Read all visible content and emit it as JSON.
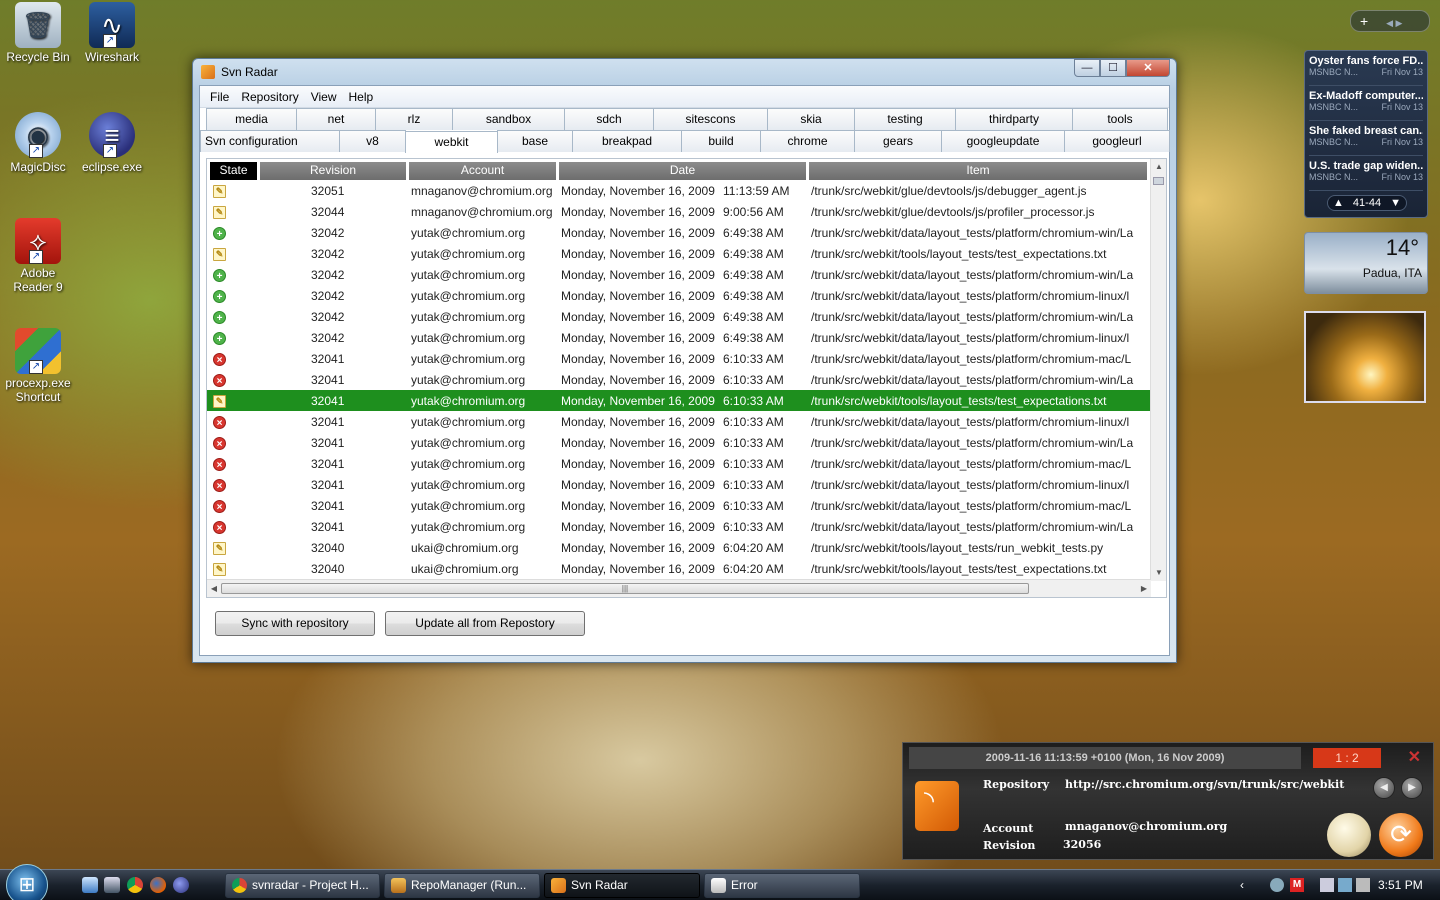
{
  "desktop": {
    "icons": [
      {
        "label": "Recycle Bin"
      },
      {
        "label": "Wireshark"
      },
      {
        "label": "MagicDisc"
      },
      {
        "label": "eclipse.exe"
      },
      {
        "label": "Adobe Reader 9"
      },
      {
        "label": "procexp.exe Shortcut"
      }
    ]
  },
  "window": {
    "title": "Svn Radar",
    "controls": {
      "minimize": "—",
      "maximize": "☐",
      "close": "✕"
    },
    "menu": [
      "File",
      "Repository",
      "View",
      "Help"
    ],
    "tabs_row1": [
      "media",
      "net",
      "rlz",
      "sandbox",
      "sdch",
      "sitescons",
      "skia",
      "testing",
      "thirdparty",
      "tools"
    ],
    "tabs_row2": [
      "Svn configuration",
      "v8",
      "webkit",
      "base",
      "breakpad",
      "build",
      "chrome",
      "gears",
      "googleupdate",
      "googleurl"
    ],
    "active_tab": "webkit",
    "columns": [
      "State",
      "Revision",
      "Account",
      "Date",
      "Item"
    ],
    "rows": [
      {
        "state": "modified",
        "revision": "32051",
        "account": "mnaganov@chromium.org",
        "date": "Monday, November 16, 2009",
        "time": "11:13:59 AM",
        "item": "/trunk/src/webkit/glue/devtools/js/debugger_agent.js"
      },
      {
        "state": "modified",
        "revision": "32044",
        "account": "mnaganov@chromium.org",
        "date": "Monday, November 16, 2009",
        "time": "9:00:56 AM",
        "item": "/trunk/src/webkit/glue/devtools/js/profiler_processor.js"
      },
      {
        "state": "added",
        "revision": "32042",
        "account": "yutak@chromium.org",
        "date": "Monday, November 16, 2009",
        "time": "6:49:38 AM",
        "item": "/trunk/src/webkit/data/layout_tests/platform/chromium-win/La"
      },
      {
        "state": "modified",
        "revision": "32042",
        "account": "yutak@chromium.org",
        "date": "Monday, November 16, 2009",
        "time": "6:49:38 AM",
        "item": "/trunk/src/webkit/tools/layout_tests/test_expectations.txt"
      },
      {
        "state": "added",
        "revision": "32042",
        "account": "yutak@chromium.org",
        "date": "Monday, November 16, 2009",
        "time": "6:49:38 AM",
        "item": "/trunk/src/webkit/data/layout_tests/platform/chromium-win/La"
      },
      {
        "state": "added",
        "revision": "32042",
        "account": "yutak@chromium.org",
        "date": "Monday, November 16, 2009",
        "time": "6:49:38 AM",
        "item": "/trunk/src/webkit/data/layout_tests/platform/chromium-linux/l"
      },
      {
        "state": "added",
        "revision": "32042",
        "account": "yutak@chromium.org",
        "date": "Monday, November 16, 2009",
        "time": "6:49:38 AM",
        "item": "/trunk/src/webkit/data/layout_tests/platform/chromium-win/La"
      },
      {
        "state": "added",
        "revision": "32042",
        "account": "yutak@chromium.org",
        "date": "Monday, November 16, 2009",
        "time": "6:49:38 AM",
        "item": "/trunk/src/webkit/data/layout_tests/platform/chromium-linux/l"
      },
      {
        "state": "deleted",
        "revision": "32041",
        "account": "yutak@chromium.org",
        "date": "Monday, November 16, 2009",
        "time": "6:10:33 AM",
        "item": "/trunk/src/webkit/data/layout_tests/platform/chromium-mac/L"
      },
      {
        "state": "deleted",
        "revision": "32041",
        "account": "yutak@chromium.org",
        "date": "Monday, November 16, 2009",
        "time": "6:10:33 AM",
        "item": "/trunk/src/webkit/data/layout_tests/platform/chromium-win/La"
      },
      {
        "state": "modified",
        "revision": "32041",
        "account": "yutak@chromium.org",
        "date": "Monday, November 16, 2009",
        "time": "6:10:33 AM",
        "item": "/trunk/src/webkit/tools/layout_tests/test_expectations.txt",
        "selected": true
      },
      {
        "state": "deleted",
        "revision": "32041",
        "account": "yutak@chromium.org",
        "date": "Monday, November 16, 2009",
        "time": "6:10:33 AM",
        "item": "/trunk/src/webkit/data/layout_tests/platform/chromium-linux/l"
      },
      {
        "state": "deleted",
        "revision": "32041",
        "account": "yutak@chromium.org",
        "date": "Monday, November 16, 2009",
        "time": "6:10:33 AM",
        "item": "/trunk/src/webkit/data/layout_tests/platform/chromium-win/La"
      },
      {
        "state": "deleted",
        "revision": "32041",
        "account": "yutak@chromium.org",
        "date": "Monday, November 16, 2009",
        "time": "6:10:33 AM",
        "item": "/trunk/src/webkit/data/layout_tests/platform/chromium-mac/L"
      },
      {
        "state": "deleted",
        "revision": "32041",
        "account": "yutak@chromium.org",
        "date": "Monday, November 16, 2009",
        "time": "6:10:33 AM",
        "item": "/trunk/src/webkit/data/layout_tests/platform/chromium-linux/l"
      },
      {
        "state": "deleted",
        "revision": "32041",
        "account": "yutak@chromium.org",
        "date": "Monday, November 16, 2009",
        "time": "6:10:33 AM",
        "item": "/trunk/src/webkit/data/layout_tests/platform/chromium-mac/L"
      },
      {
        "state": "deleted",
        "revision": "32041",
        "account": "yutak@chromium.org",
        "date": "Monday, November 16, 2009",
        "time": "6:10:33 AM",
        "item": "/trunk/src/webkit/data/layout_tests/platform/chromium-win/La"
      },
      {
        "state": "modified",
        "revision": "32040",
        "account": "ukai@chromium.org",
        "date": "Monday, November 16, 2009",
        "time": "6:04:20 AM",
        "item": "/trunk/src/webkit/tools/layout_tests/run_webkit_tests.py"
      },
      {
        "state": "modified",
        "revision": "32040",
        "account": "ukai@chromium.org",
        "date": "Monday, November 16, 2009",
        "time": "6:04:20 AM",
        "item": "/trunk/src/webkit/tools/layout_tests/test_expectations.txt"
      }
    ],
    "buttons": {
      "sync": "Sync with repository",
      "update": "Update all from Repostory"
    }
  },
  "sidebar": {
    "controls": "+",
    "news": [
      {
        "title": "Oyster fans force FD...",
        "source": "MSNBC N...",
        "date": "Fri Nov 13"
      },
      {
        "title": "Ex-Madoff computer...",
        "source": "MSNBC N...",
        "date": "Fri Nov 13"
      },
      {
        "title": "She faked breast can...",
        "source": "MSNBC N...",
        "date": "Fri Nov 13"
      },
      {
        "title": "U.S. trade gap widen...",
        "source": "MSNBC N...",
        "date": "Fri Nov 13"
      }
    ],
    "news_pager": "41-44",
    "weather": {
      "temp": "14°",
      "city": "Padua, ITA"
    }
  },
  "notification": {
    "date": "2009-11-16 11:13:59 +0100 (Mon, 16 Nov 2009)",
    "count": "1 : 2",
    "close": "✕",
    "repository_label": "Repository",
    "repository_value": "http://src.chromium.org/svn/trunk/src/webkit",
    "account_label": "Account",
    "account_value": "mnaganov@chromium.org",
    "revision_label": "Revision",
    "revision_value": "32056"
  },
  "taskbar": {
    "tasks": [
      {
        "label": "svnradar - Project H...",
        "active": false
      },
      {
        "label": "RepoManager (Run...",
        "active": false
      },
      {
        "label": "Svn Radar",
        "active": true
      },
      {
        "label": "Error",
        "active": false
      }
    ],
    "clock": "3:51 PM"
  }
}
